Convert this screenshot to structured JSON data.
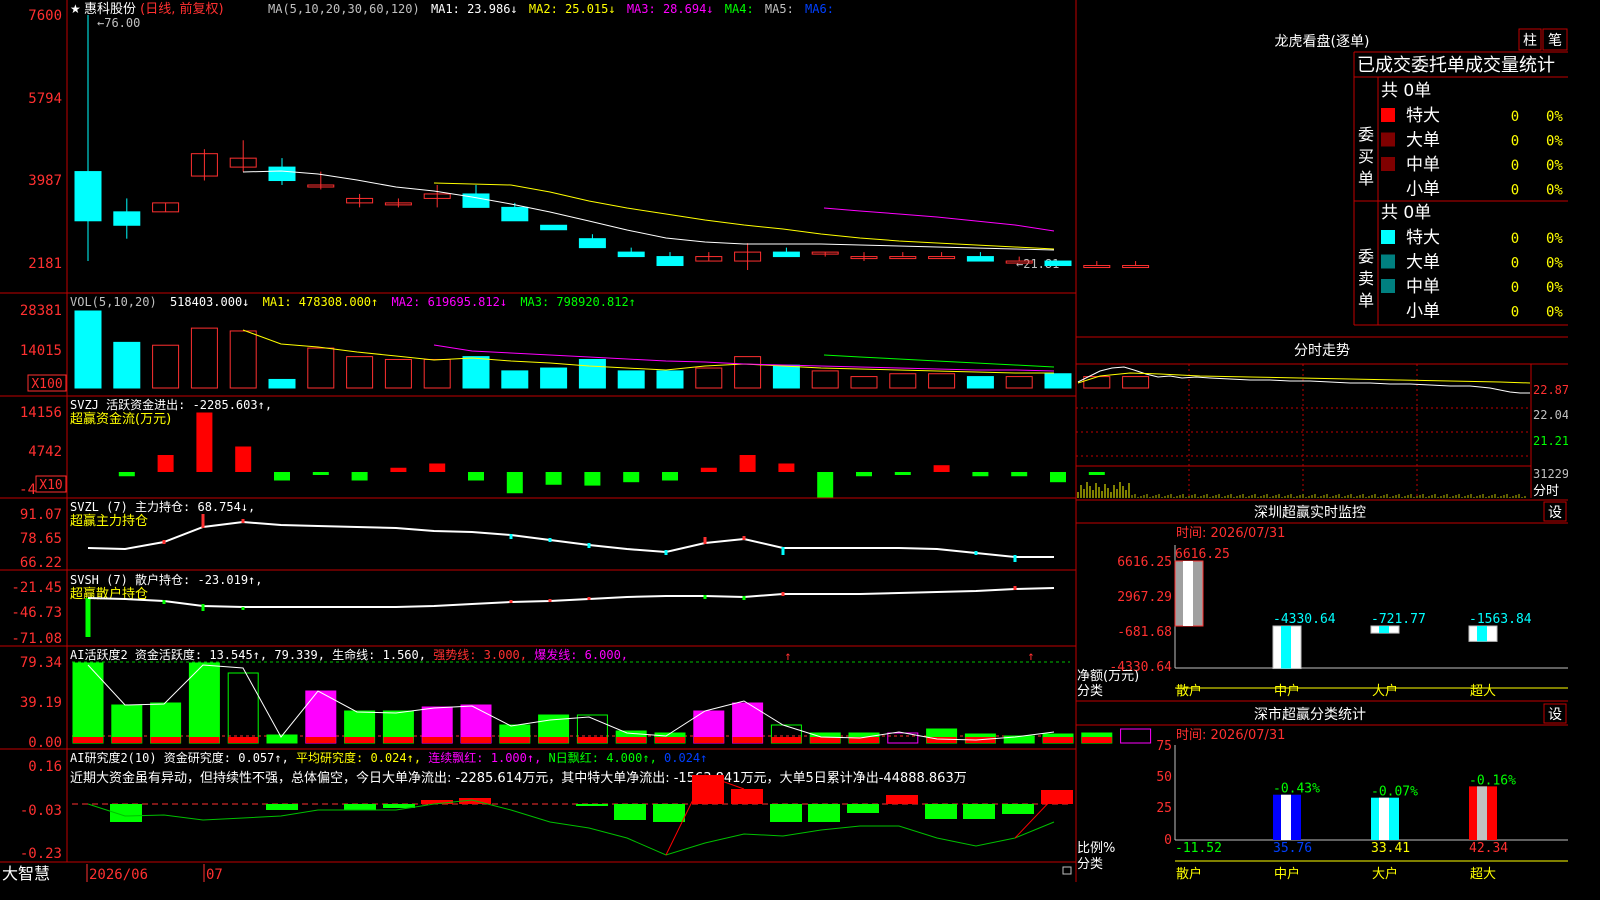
{
  "colors": {
    "up": "#ff3030",
    "down": "#00ffff",
    "grid": "#c00000",
    "panel_bg": "#000000",
    "yellow": "#ffff00",
    "magenta": "#ff00ff",
    "green": "#00ff00",
    "white": "#ffffff",
    "grey": "#c0c0c0"
  },
  "kline": {
    "star": "★",
    "stock_name": "惠科股份",
    "period": "(日线, 前复权)",
    "ma_params": "MA(5,10,20,30,60,120)",
    "ma1": "MA1: 23.986↓",
    "ma2": "MA2: 25.015↓",
    "ma3": "MA3: 28.694↓",
    "ma4": "MA4:",
    "ma5": "MA5:",
    "ma6": "MA6:",
    "high_note": "76.00",
    "low_note": "21.81",
    "y_labels": [
      "7600",
      "5794",
      "3987",
      "2181"
    ],
    "ohlc": [
      [
        42,
        77,
        22,
        31
      ],
      [
        33,
        36,
        27,
        30
      ],
      [
        33,
        35,
        33,
        35
      ],
      [
        41,
        47,
        40,
        46
      ],
      [
        43,
        49,
        42,
        45
      ],
      [
        43,
        45,
        39,
        40
      ],
      [
        39,
        42,
        38,
        39
      ],
      [
        35,
        37,
        34,
        36
      ],
      [
        35,
        36,
        34,
        35
      ],
      [
        36,
        39,
        34,
        37
      ],
      [
        37,
        39,
        35,
        34
      ],
      [
        34,
        35,
        31,
        31
      ],
      [
        30,
        30,
        29,
        29
      ],
      [
        27,
        28,
        25,
        25
      ],
      [
        24,
        25,
        24,
        23
      ],
      [
        23,
        24,
        21,
        21
      ],
      [
        22,
        24,
        22,
        23
      ],
      [
        22,
        26,
        20,
        24
      ],
      [
        24,
        25,
        23,
        23
      ],
      [
        24,
        24,
        23,
        24
      ],
      [
        23,
        24,
        22,
        23
      ],
      [
        23,
        24,
        23,
        23
      ],
      [
        23,
        24,
        23,
        23
      ],
      [
        23,
        24,
        22,
        22
      ],
      [
        22,
        23,
        22,
        22
      ],
      [
        22,
        22,
        21,
        21
      ],
      [
        21,
        22,
        21,
        21
      ],
      [
        21,
        22,
        21,
        21
      ]
    ]
  },
  "vol": {
    "title": "VOL(5,10,20)",
    "value": "518403.000↓",
    "ma1": "MA1: 478308.000↑",
    "ma2": "MA2: 619695.812↓",
    "ma3": "MA3: 798920.812↑",
    "y_labels": [
      "28381",
      "14015"
    ],
    "unit": "X100",
    "values": [
      27,
      16,
      15,
      21,
      20,
      3,
      14,
      11,
      10,
      10,
      11,
      6,
      7,
      10,
      6,
      6,
      7,
      11,
      8,
      6,
      4,
      5,
      5,
      4,
      4,
      5,
      4,
      4
    ]
  },
  "svzj": {
    "title": "SVZJ  活跃资金进出: -2285.603↑,",
    "subtitle": "超赢资金流(万元)",
    "y_labels": [
      "14156",
      "4742",
      "-4"
    ],
    "unit": "X10",
    "values": [
      -0.5,
      2,
      7,
      3,
      -1,
      -0.2,
      -1,
      0.5,
      1,
      -1,
      -2.5,
      -1.5,
      -1.6,
      -1.2,
      -1,
      0.5,
      2,
      1,
      -3,
      -0.5,
      -0.3,
      0.8,
      -0.5,
      -0.5,
      -1.2,
      -0.2
    ]
  },
  "svzl": {
    "title": "SVZL (7) 主力持仓: 68.754↓,",
    "subtitle": "超赢主力持仓",
    "y_labels": [
      "91.07",
      "78.65",
      "66.22"
    ]
  },
  "svsh": {
    "title": "SVSH (7) 散户持仓: -23.019↑,",
    "subtitle": "超赢散户持仓",
    "y_labels": [
      "-21.45",
      "-46.73",
      "-71.08"
    ]
  },
  "ai1": {
    "title": "AI活跃度2 资金活跃度: 13.545↑, 79.339, 生命线: 1.560, ",
    "strong": "强势线: 3.000, ",
    "burst": "爆发线: 6.000,",
    "y_labels": [
      "79.34",
      "39.19",
      "0.00"
    ],
    "values": [
      80,
      38,
      40,
      80,
      70,
      8,
      52,
      32,
      32,
      36,
      38,
      18,
      28,
      28,
      12,
      10,
      32,
      40,
      18,
      10,
      10,
      10,
      14,
      9,
      7,
      9,
      10,
      14
    ]
  },
  "ai2": {
    "title": "AI研究度2(10) 资金研究度: 0.057↑, ",
    "avg": "平均研究度: 0.024↑, ",
    "hong": "连续飘红: 1.000↑, ",
    "nday": "N日飘红: 4.000↑, ",
    "tail": "0.024↑",
    "summary": "近期大资金虽有异动，但持续性不强，总体偏空，今日大单净流出: -2285.614万元，其中特大单净流出: -1563.841万元，大单5日累计净出-44888.863万",
    "y_labels": [
      "0.16",
      "-0.03",
      "-0.23"
    ]
  },
  "bottom": {
    "logo": "大智慧",
    "date1": "2026/06",
    "date2": "07"
  },
  "lhb": {
    "title": "龙虎看盘(逐单)",
    "btn_bar": "柱",
    "btn_pen": "笔",
    "header": "已成交委托单成交量统计",
    "buy_label": "委买单",
    "sell_label": "委卖单",
    "buy_total": "共 0单",
    "sell_total": "共 0单",
    "buy_rows": [
      {
        "name": "特大",
        "count": "0",
        "pct": "0%",
        "color": "#ff0000"
      },
      {
        "name": "大单",
        "count": "0",
        "pct": "0%",
        "color": "#800000"
      },
      {
        "name": "中单",
        "count": "0",
        "pct": "0%",
        "color": "#800000"
      },
      {
        "name": "小单",
        "count": "0",
        "pct": "0%",
        "color": ""
      }
    ],
    "sell_rows": [
      {
        "name": "特大",
        "count": "0",
        "pct": "0%",
        "color": "#00ffff"
      },
      {
        "name": "大单",
        "count": "0",
        "pct": "0%",
        "color": "#008080"
      },
      {
        "name": "中单",
        "count": "0",
        "pct": "0%",
        "color": "#008080"
      },
      {
        "name": "小单",
        "count": "0",
        "pct": "0%",
        "color": ""
      }
    ]
  },
  "fenshi": {
    "title": "分时走势",
    "y_labels": [
      "22.87",
      "22.04",
      "21.21",
      "31229"
    ],
    "unit": "分时"
  },
  "sz_monitor": {
    "title": "深圳超赢实时监控",
    "btn": "设",
    "time": "时间: 2026/07/31",
    "y_labels": [
      "6616.25",
      "2967.29",
      "-681.68",
      "-4330.64"
    ],
    "net_label": "净额(万元)",
    "cat_label": "分类",
    "cats": [
      "散户",
      "中户",
      "大户",
      "超大"
    ],
    "values": [
      6616.25,
      -4330.64,
      -721.77,
      -1563.84
    ],
    "value_labels": [
      "6616.25",
      "-4330.64",
      "-721.77",
      "-1563.84"
    ]
  },
  "sz_class": {
    "title": "深市超赢分类统计",
    "btn": "设",
    "time": "时间: 2026/07/31",
    "y_labels": [
      "75",
      "50",
      "25",
      "0"
    ],
    "ratio_label": "比例%",
    "cat_label": "分类",
    "cats": [
      "散户",
      "中户",
      "大户",
      "超大"
    ],
    "bars": [
      0,
      35.76,
      33.41,
      42.34
    ],
    "top_labels": [
      "",
      "-0.43%",
      "-0.07%",
      "-0.16%"
    ],
    "bottom_labels": [
      "-11.52",
      "35.76",
      "33.41",
      "42.34"
    ]
  }
}
